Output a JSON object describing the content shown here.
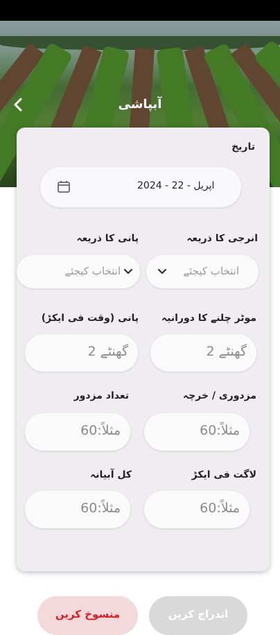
{
  "header": {
    "title": "آبپاشی",
    "back_icon": "chevron-left-icon"
  },
  "form": {
    "date_label": "تاریخ",
    "date_value": "اپریل - 22 - 2024",
    "date_icon": "calendar-icon",
    "energy_source_label": "انرجی کا ذریعہ",
    "energy_source_placeholder": "انتخاب کیجئے",
    "water_source_label": "پانی کا ذریعہ",
    "water_source_placeholder": "انتخاب کیجئے",
    "motor_duration_label": "موٹر چلنے کا دورانیہ",
    "motor_duration_placeholder": "گھنٹے 2",
    "water_per_acre_label": "پانی (وقت فی ایکڑ)",
    "water_per_acre_placeholder": "گھنٹے 2",
    "labor_cost_label": "مزدوری / خرچہ",
    "labor_cost_placeholder": "مثلاً:60",
    "labor_count_label": "تعداد مزدور",
    "labor_count_placeholder": "مثلاً:60",
    "cost_per_acre_label": "لاگت فی ایکڑ",
    "cost_per_acre_placeholder": "مثلاً:60",
    "total_water_fee_label": "کل آبیانہ",
    "total_water_fee_placeholder": "مثلاً:60"
  },
  "actions": {
    "submit_label": "اندراج کریں",
    "cancel_label": "منسوخ کریں"
  },
  "colors": {
    "cancel_text": "#e01b24",
    "cancel_bg": "#f3d9db",
    "submit_bg": "#d9d9d9",
    "card_bg": "#efedf1"
  }
}
